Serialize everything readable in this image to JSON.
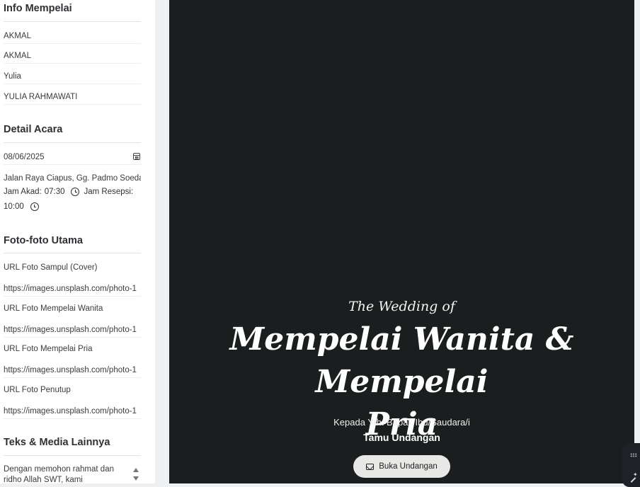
{
  "sidebar": {
    "info_mempelai": {
      "title": "Info Mempelai",
      "fields": [
        "AKMAL",
        "AKMAL",
        "Yulia",
        "YULIA RAHMAWATI"
      ]
    },
    "detail_acara": {
      "title": "Detail Acara",
      "date_value": "08/06/2025",
      "address_value": "Jalan Raya Ciapus, Gg. Padmo Soedarmo",
      "jam_akad_label": "Jam Akad:",
      "jam_akad_value": "07:30",
      "jam_resepsi_label": "Jam Resepsi:",
      "jam_resepsi_value": "10:00"
    },
    "foto_utama": {
      "title": "Foto-foto Utama",
      "items": [
        {
          "label": "URL Foto Sampul (Cover)",
          "value": "https://images.unsplash.com/photo-1"
        },
        {
          "label": "URL Foto Mempelai Wanita",
          "value": "https://images.unsplash.com/photo-1"
        },
        {
          "label": "URL Foto Mempelai Pria",
          "value": "https://images.unsplash.com/photo-1"
        },
        {
          "label": "URL Foto Penutup",
          "value": "https://images.unsplash.com/photo-1"
        }
      ]
    },
    "teks_media": {
      "title": "Teks & Media Lainnya",
      "textarea_value": "Dengan memohon rahmat dan ridho Allah SWT, kami"
    }
  },
  "preview": {
    "kicker": "The Wedding of",
    "couple_line1": "Mempelai Wanita & Mempelai",
    "couple_line2": "Pria",
    "to_line": "Kepada Yth: Bapak/Ibu/Saudara/i",
    "guest": "Tamu Undangan",
    "open_button": "Buka Undangan"
  },
  "icons": {
    "calendar": "calendar-icon",
    "clock": "clock-icon",
    "mail": "mail-icon",
    "grip": "grip-icon",
    "wand": "magic-wand-icon"
  },
  "colors": {
    "preview_bg": "#1b1e1f",
    "button_bg": "#e8e8e6",
    "sidebar_bg": "#ffffff"
  }
}
